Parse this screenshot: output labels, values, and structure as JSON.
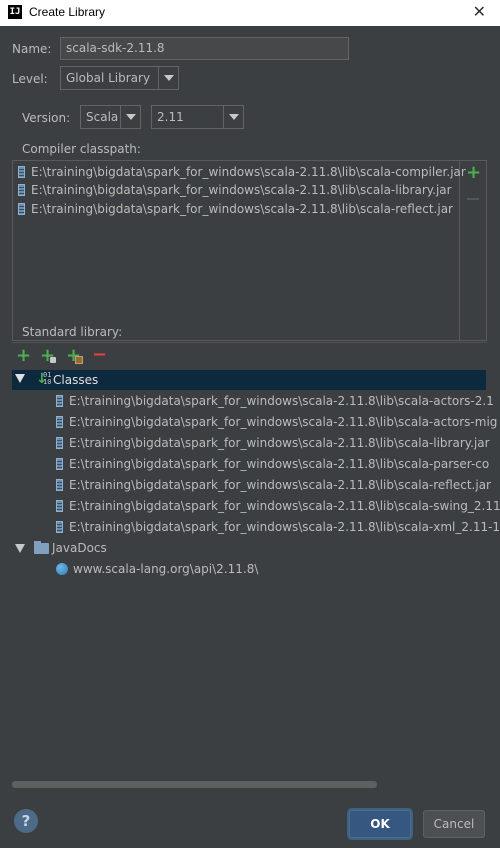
{
  "window": {
    "title": "Create Library",
    "close_glyph": "✕"
  },
  "form": {
    "name_label": "Name:",
    "name_value": "scala-sdk-2.11.8",
    "level_label": "Level:",
    "level_value": "Global Library",
    "version_label": "Version:",
    "version_type_value": "Scala",
    "version_number_value": "2.11"
  },
  "compiler": {
    "label": "Compiler classpath:",
    "items": [
      "E:\\training\\bigdata\\spark_for_windows\\scala-2.11.8\\lib\\scala-compiler.jar",
      "E:\\training\\bigdata\\spark_for_windows\\scala-2.11.8\\lib\\scala-library.jar",
      "E:\\training\\bigdata\\spark_for_windows\\scala-2.11.8\\lib\\scala-reflect.jar"
    ]
  },
  "stdlib": {
    "label": "Standard library:",
    "classes_label": "Classes",
    "classes": [
      "E:\\training\\bigdata\\spark_for_windows\\scala-2.11.8\\lib\\scala-actors-2.1",
      "E:\\training\\bigdata\\spark_for_windows\\scala-2.11.8\\lib\\scala-actors-mig",
      "E:\\training\\bigdata\\spark_for_windows\\scala-2.11.8\\lib\\scala-library.jar",
      "E:\\training\\bigdata\\spark_for_windows\\scala-2.11.8\\lib\\scala-parser-co",
      "E:\\training\\bigdata\\spark_for_windows\\scala-2.11.8\\lib\\scala-reflect.jar",
      "E:\\training\\bigdata\\spark_for_windows\\scala-2.11.8\\lib\\scala-swing_2.11",
      "E:\\training\\bigdata\\spark_for_windows\\scala-2.11.8\\lib\\scala-xml_2.11-1"
    ],
    "javadocs_label": "JavaDocs",
    "javadocs_url": "www.scala-lang.org\\api\\2.11.8\\"
  },
  "buttons": {
    "ok": "OK",
    "cancel": "Cancel",
    "help": "?"
  },
  "colors": {
    "background": "#3c3f41",
    "selection": "#0d293e",
    "accent_green": "#4caf50",
    "accent_red": "#e04141"
  },
  "icons": [
    "app-logo-icon",
    "close-icon",
    "chevron-down-icon",
    "add-icon",
    "jar-icon",
    "folder-icon",
    "globe-icon",
    "remove-icon",
    "help-icon"
  ]
}
